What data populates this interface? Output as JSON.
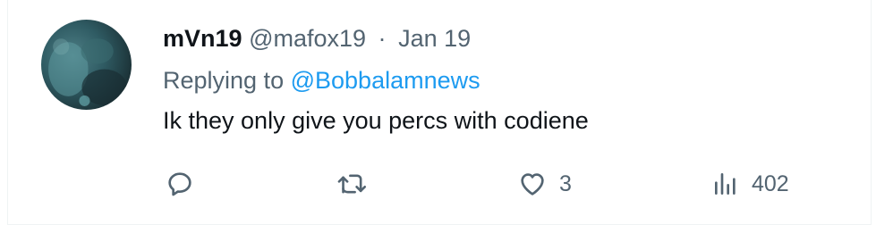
{
  "tweet": {
    "author": {
      "display_name": "mVn19",
      "handle": "@mafox19",
      "separator": "·",
      "date": "Jan 19"
    },
    "reply_context": {
      "prefix": "Replying to",
      "mention": "@Bobbalamnews"
    },
    "text": "Ik they only give you percs with codiene",
    "actions": {
      "reply_icon": "speech-bubble-icon",
      "retweet_icon": "retweet-arrows-icon",
      "like_icon": "heart-icon",
      "like_count": "3",
      "views_icon": "bar-chart-icon",
      "views_count": "402"
    }
  },
  "colors": {
    "primary_text": "#0f1419",
    "secondary_text": "#536471",
    "accent": "#1d9bf0"
  }
}
